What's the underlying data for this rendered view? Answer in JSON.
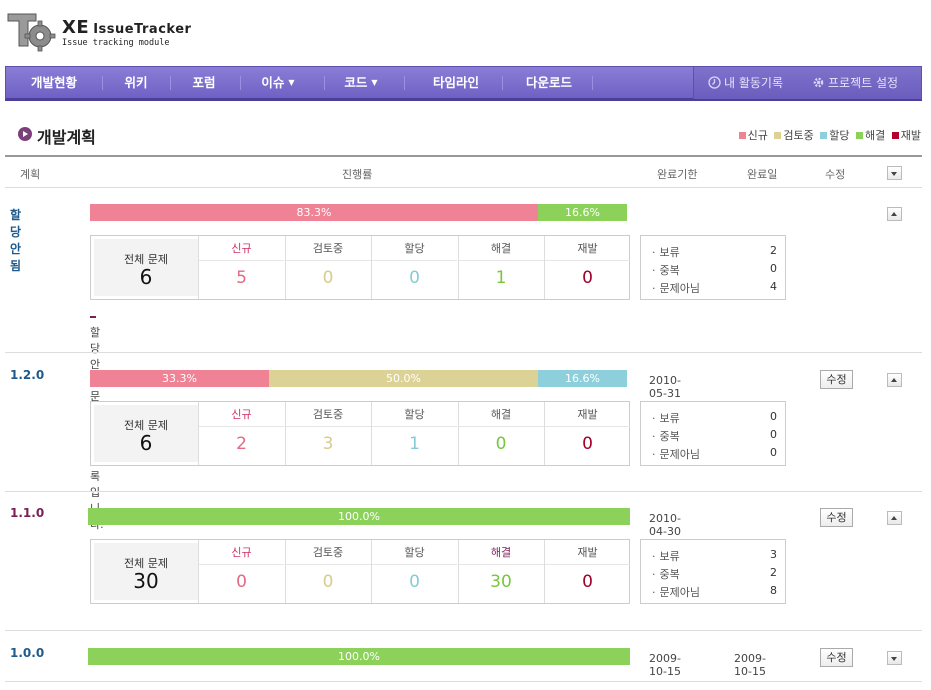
{
  "logo": {
    "brand": "XE",
    "name": "IssueTracker",
    "subtitle": "Issue tracking module"
  },
  "nav": {
    "items": [
      {
        "label": "개발현황"
      },
      {
        "label": "위키"
      },
      {
        "label": "포럼"
      },
      {
        "label": "이슈",
        "dropdown": true
      },
      {
        "label": "코드",
        "dropdown": true
      },
      {
        "label": "타임라인"
      },
      {
        "label": "다운로드"
      }
    ],
    "right": [
      {
        "label": "내 활동기록",
        "icon": "clock-icon"
      },
      {
        "label": "프로젝트 설정",
        "icon": "gear-icon"
      }
    ]
  },
  "page": {
    "title": "개발계획"
  },
  "legend": [
    {
      "label": "신규",
      "color": "#f08296"
    },
    {
      "label": "검토중",
      "color": "#dcd296"
    },
    {
      "label": "할당",
      "color": "#8ecfdc"
    },
    {
      "label": "해결",
      "color": "#8cd25a"
    },
    {
      "label": "재발",
      "color": "#b4002d"
    }
  ],
  "table": {
    "headers": {
      "plan": "계획",
      "progress": "진행률",
      "due": "완료기한",
      "done": "완료일",
      "edit": "수정"
    }
  },
  "stats_labels": {
    "total": "전체 문제",
    "new": "신규",
    "review": "검토중",
    "assigned": "할당",
    "resolved": "해결",
    "reopened": "재발",
    "hold": "보류",
    "duplicate": "중복",
    "not_issue": "문제아님"
  },
  "colors": {
    "new": "#f08296",
    "review": "#dcd296",
    "assigned": "#8ecfdc",
    "resolved": "#8cd25a",
    "reopened": "#b4002d",
    "nav": "#7266c8",
    "accent": "#7b3f7a"
  },
  "plans": [
    {
      "name": "할당 안됨",
      "segments": [
        {
          "type": "new",
          "label": "83.3%",
          "fraction": 0.833
        },
        {
          "type": "resolved",
          "label": "16.6%",
          "fraction": 0.166
        }
      ],
      "stats": {
        "total": "6",
        "new": "5",
        "review": "0",
        "assigned": "0",
        "resolved": "1",
        "reopened": "0"
      },
      "extra": {
        "hold": "2",
        "duplicate": "0",
        "not_issue": "4"
      },
      "due": "",
      "done": "",
      "editable": false,
      "description": "할당 안된 문제들의 목록입니다."
    },
    {
      "name": "1.2.0",
      "segments": [
        {
          "type": "new",
          "label": "33.3%",
          "fraction": 0.333
        },
        {
          "type": "review",
          "label": "50.0%",
          "fraction": 0.5
        },
        {
          "type": "assigned",
          "label": "16.6%",
          "fraction": 0.166
        }
      ],
      "stats": {
        "total": "6",
        "new": "2",
        "review": "3",
        "assigned": "1",
        "resolved": "0",
        "reopened": "0"
      },
      "extra": {
        "hold": "0",
        "duplicate": "0",
        "not_issue": "0"
      },
      "due": "2010-05-31",
      "done": "",
      "editable": true,
      "edit_label": "수정"
    },
    {
      "name": "1.1.0",
      "segments": [
        {
          "type": "resolved",
          "label": "100.0%",
          "fraction": 1.0
        }
      ],
      "stats": {
        "total": "30",
        "new": "0",
        "review": "0",
        "assigned": "0",
        "resolved": "30",
        "reopened": "0"
      },
      "extra": {
        "hold": "3",
        "duplicate": "2",
        "not_issue": "8"
      },
      "due": "2010-04-30",
      "done": "",
      "editable": true,
      "edit_label": "수정"
    },
    {
      "name": "1.0.0",
      "segments": [
        {
          "type": "resolved",
          "label": "100.0%",
          "fraction": 1.0
        }
      ],
      "due": "2009-10-15",
      "done": "2009-10-15",
      "editable": true,
      "edit_label": "수정",
      "collapsed": true
    }
  ]
}
